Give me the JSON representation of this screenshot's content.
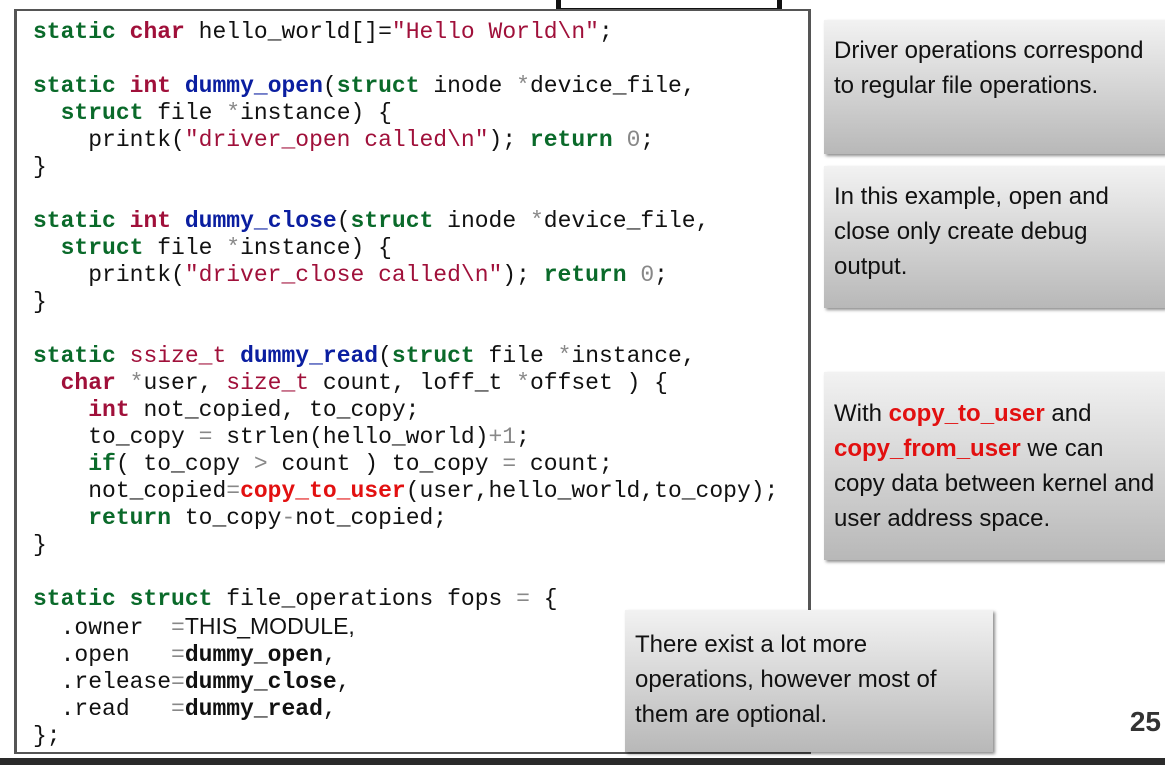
{
  "code": {
    "l1_kw1": "static",
    "l1_ty": "char",
    "l1_txt": " hello_world[]=",
    "l1_str": "\"Hello World\\n\"",
    "l1_end": ";",
    "open_sig_kw1": "static",
    "open_sig_ty": "int",
    "open_fn": "dummy_open",
    "open_paren": "(",
    "open_kw2": "struct",
    "open_txt": " inode ",
    "open_star": "*",
    "open_param": "device_file,",
    "open_l2_kw": "struct",
    "open_l2_txt": " file ",
    "open_l2_star": "*",
    "open_l2_rest": "instance) {",
    "open_l3_a": "printk(",
    "open_l3_str": "\"driver_open called\\n\"",
    "open_l3_b": "); ",
    "open_l3_ret": "return",
    "open_l3_num": "0",
    "open_l3_end": ";",
    "close_brace": "}",
    "close_sig_kw1": "static",
    "close_sig_ty": "int",
    "close_fn": "dummy_close",
    "close_paren": "(",
    "close_kw2": "struct",
    "close_txt": " inode ",
    "close_star": "*",
    "close_param": "device_file,",
    "close_l2_kw": "struct",
    "close_l2_txt": " file ",
    "close_l2_star": "*",
    "close_l2_rest": "instance) {",
    "close_l3_a": "printk(",
    "close_l3_str": "\"driver_close called\\n\"",
    "close_l3_b": "); ",
    "close_l3_ret": "return",
    "close_l3_num": "0",
    "close_l3_end": ";",
    "read_kw1": "static",
    "read_ty": "ssize_t",
    "read_fn": "dummy_read",
    "read_paren": "(",
    "read_kw2": "struct",
    "read_txt": " file ",
    "read_star": "*",
    "read_param": "instance,",
    "read_l2_ty": "char",
    "read_l2_star": " *",
    "read_l2_a": "user, ",
    "read_l2_ty2": "size_t",
    "read_l2_b": " count, loff_t ",
    "read_l2_star2": "*",
    "read_l2_c": "offset ) {",
    "read_l3_ty": "int",
    "read_l3_txt": " not_copied, to_copy;",
    "read_l4_a": "to_copy ",
    "read_l4_eq": "=",
    "read_l4_b": " strlen(hello_world)",
    "read_l4_plus": "+1",
    "read_l4_end": ";",
    "read_l5_kw": "if",
    "read_l5_a": "( to_copy ",
    "read_l5_gt": ">",
    "read_l5_b": " count ) to_copy ",
    "read_l5_eq": "=",
    "read_l5_c": " count;",
    "read_l6_a": "not_copied",
    "read_l6_eq": "=",
    "read_l6_fn": "copy_to_user",
    "read_l6_b": "(user,hello_world,to_copy);",
    "read_l7_kw": "return",
    "read_l7_a": " to_copy",
    "read_l7_minus": "-",
    "read_l7_b": "not_copied;",
    "fops_kw1": "static",
    "fops_kw2": "struct",
    "fops_txt": " file_operations fops ",
    "fops_eq": "=",
    "fops_end": " {",
    "f_owner": ".owner  ",
    "f_owner_eq": "=",
    "f_owner_val": "THIS_MODULE,",
    "f_open": ".open   ",
    "f_open_eq": "=",
    "f_open_val": "dummy_open",
    "f_open_c": ",",
    "f_release": ".release",
    "f_release_eq": "=",
    "f_release_val": "dummy_close",
    "f_release_c": ",",
    "f_read": ".read   ",
    "f_read_eq": "=",
    "f_read_val": "dummy_read",
    "f_read_c": ",",
    "f_end": "};"
  },
  "notes": {
    "n1": "Driver operations correspond to regular file operations.",
    "n2": "In this example, open and close only create debug output.",
    "n3_a": "With ",
    "n3_hl1": "copy_to_user",
    "n3_b": " and ",
    "n3_hl2": "copy_from_user",
    "n3_c": " we can copy data between kernel and user address space.",
    "n4": "There exist a lot more operations, however most of them are optional."
  },
  "page_number": "25"
}
